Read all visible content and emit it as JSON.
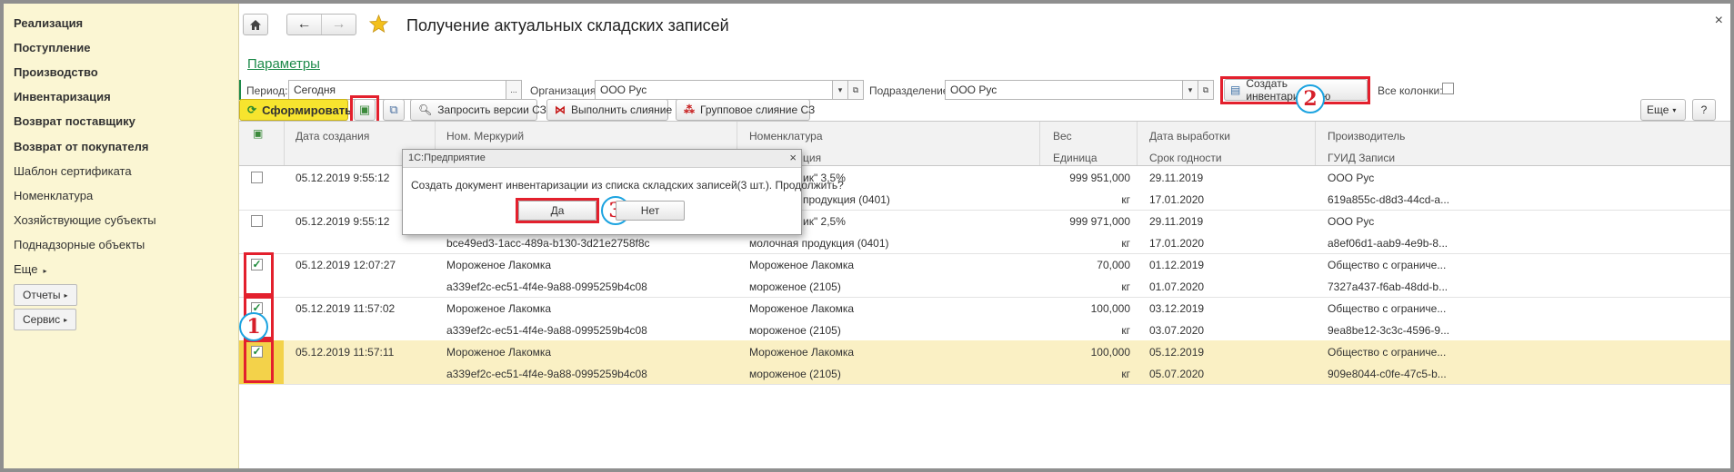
{
  "sidebar": {
    "bold_items": [
      "Реализация",
      "Поступление",
      "Производство",
      "Инвентаризация",
      "Возврат поставщику",
      "Возврат от покупателя"
    ],
    "items": [
      "Шаблон сертификата",
      "Номенклатура",
      "Хозяйствующие субъекты",
      "Поднадзорные объекты"
    ],
    "more_label": "Еще",
    "reports_label": "Отчеты",
    "service_label": "Сервис"
  },
  "window": {
    "title": "Получение актуальных складских записей",
    "close": "×",
    "home_icon": "home-icon",
    "star_icon": "star-icon"
  },
  "params": {
    "link": "Параметры",
    "period_label": "Период:",
    "period_value": "Сегодня",
    "org_label": "Организация:",
    "org_value": "ООО  Рус",
    "division_label": "Подразделение:",
    "division_value": "ООО Рус",
    "create_inventory_label": "Создать инвентаризацию",
    "all_columns_label": "Все колонки:"
  },
  "toolbar": {
    "generate_label": "Сформировать",
    "request_versions_label": "Запросить версии СЗ",
    "merge_label": "Выполнить слияние",
    "group_merge_label": "Групповое слияние СЗ",
    "more_label": "Еще",
    "help_label": "?"
  },
  "table": {
    "headers_top": [
      "Дата создания",
      "Ном. Меркурий",
      "Номенклатура",
      "Вес",
      "Дата выработки",
      "Производитель"
    ],
    "headers_bottom": [
      "ция",
      "Единица",
      "Срок годности",
      "ГУИД Записи"
    ],
    "rows": [
      {
        "checked": "",
        "date": "05.12.2019 9:55:12",
        "merc": "",
        "merc2": "",
        "nom": "ик\" 3,5%",
        "nom2": "продукция (0401)",
        "weight": "999 951,000",
        "unit": "кг",
        "prod_date": "29.11.2019",
        "expiry": "17.01.2020",
        "producer": "ООО Рус",
        "guid": "619a855c-d8d3-44cd-a..."
      },
      {
        "checked": "",
        "date": "05.12.2019 9:55:12",
        "merc": "",
        "merc2": "bce49ed3-1acc-489a-b130-3d21e2758f8c",
        "nom": "ик\" 2,5%",
        "nom2": "молочная продукция (0401)",
        "weight": "999 971,000",
        "unit": "кг",
        "prod_date": "29.11.2019",
        "expiry": "17.01.2020",
        "producer": "ООО Рус",
        "guid": "a8ef06d1-aab9-4e9b-8..."
      },
      {
        "checked": "✓",
        "date": "05.12.2019 12:07:27",
        "merc": "Мороженое Лакомка",
        "merc2": "a339ef2c-ec51-4f4e-9a88-0995259b4c08",
        "nom": "Мороженое Лакомка",
        "nom2": "мороженое (2105)",
        "weight": "70,000",
        "unit": "кг",
        "prod_date": "01.12.2019",
        "expiry": "01.07.2020",
        "producer": "Общество с ограниче...",
        "guid": "7327a437-f6ab-48dd-b..."
      },
      {
        "checked": "✓",
        "date": "05.12.2019 11:57:02",
        "merc": "Мороженое Лакомка",
        "merc2": "a339ef2c-ec51-4f4e-9a88-0995259b4c08",
        "nom": "Мороженое Лакомка",
        "nom2": "мороженое (2105)",
        "weight": "100,000",
        "unit": "кг",
        "prod_date": "03.12.2019",
        "expiry": "03.07.2020",
        "producer": "Общество с ограниче...",
        "guid": "9ea8be12-3c3c-4596-9..."
      },
      {
        "checked": "✓",
        "date": "05.12.2019 11:57:11",
        "merc": "Мороженое Лакомка",
        "merc2": "a339ef2c-ec51-4f4e-9a88-0995259b4c08",
        "nom": "Мороженое Лакомка",
        "nom2": "мороженое (2105)",
        "weight": "100,000",
        "unit": "кг",
        "prod_date": "05.12.2019",
        "expiry": "05.07.2020",
        "producer": "Общество с ограниче...",
        "guid": "909e8044-c0fe-47c5-b..."
      }
    ]
  },
  "dialog": {
    "title": "1С:Предприятие",
    "message": "Создать документ инвентаризации из списка складских записей(3 шт.). Продолжить?",
    "yes_label": "Да",
    "no_label": "Нет"
  },
  "callouts": [
    "1",
    "2",
    "3"
  ],
  "colors": {
    "accent_yellow": "#f7e42e",
    "sidebar_bg": "#fbf6d3",
    "highlight_red": "#e3202d",
    "callout_blue": "#1ba3e0",
    "link_green": "#1d8a4a"
  }
}
